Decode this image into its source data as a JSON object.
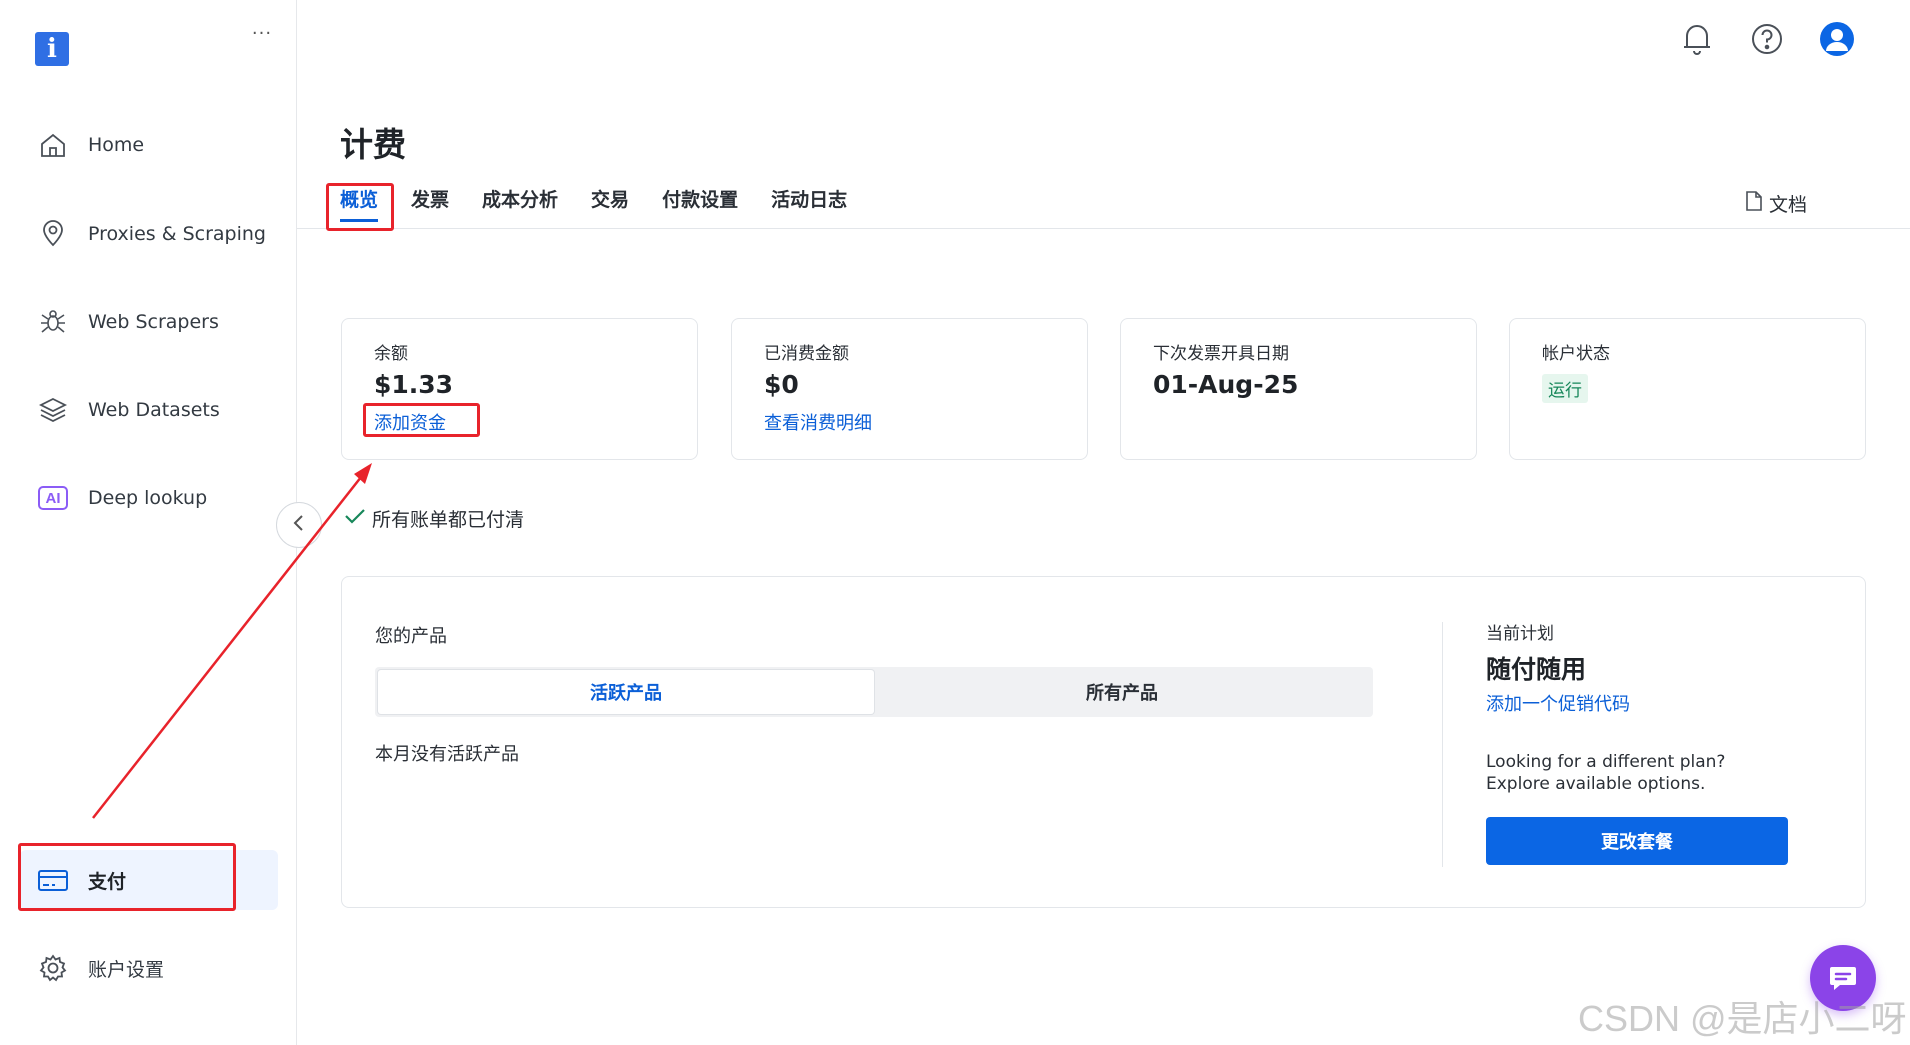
{
  "sidebar": {
    "more_label": "···",
    "logo_letter": "i",
    "items": [
      {
        "label": "Home",
        "icon": "home-icon"
      },
      {
        "label": "Proxies & Scraping",
        "icon": "location-pin-icon"
      },
      {
        "label": "Web Scrapers",
        "icon": "spider-icon"
      },
      {
        "label": "Web Datasets",
        "icon": "layers-icon"
      },
      {
        "label": "Deep lookup",
        "icon": "ai-badge-icon",
        "badge": "AI"
      },
      {
        "label": "支付",
        "icon": "credit-card-icon",
        "active": true
      },
      {
        "label": "账户设置",
        "icon": "gear-icon"
      }
    ]
  },
  "topbar": {
    "icons": [
      "bell-icon",
      "help-icon",
      "user-avatar-icon"
    ]
  },
  "page": {
    "title": "计费",
    "tabs": [
      "概览",
      "发票",
      "成本分析",
      "交易",
      "付款设置",
      "活动日志"
    ],
    "active_tab": "概览",
    "docs_label": "文档"
  },
  "cards": {
    "balance": {
      "label": "余额",
      "value": "$1.33",
      "link": "添加资金"
    },
    "spent": {
      "label": "已消费金额",
      "value": "$0",
      "link": "查看消费明细"
    },
    "next_invoice": {
      "label": "下次发票开具日期",
      "value": "01-Aug-25"
    },
    "account_status": {
      "label": "帐户状态",
      "status": "运行"
    }
  },
  "paid_note": "所有账单都已付清",
  "products": {
    "heading": "您的产品",
    "segments": [
      "活跃产品",
      "所有产品"
    ],
    "active_segment": "活跃产品",
    "empty_message": "本月没有活跃产品"
  },
  "plan": {
    "label": "当前计划",
    "name": "随付随用",
    "promo_link": "添加一个促销代码",
    "hint_line1": "Looking for a different plan?",
    "hint_line2": "Explore available options.",
    "change_button": "更改套餐"
  },
  "colors": {
    "accent": "#0b5fd7",
    "annotation_red": "#e8232b",
    "chat_purple": "#8b44e8"
  },
  "watermark": "CSDN @是店小二呀"
}
